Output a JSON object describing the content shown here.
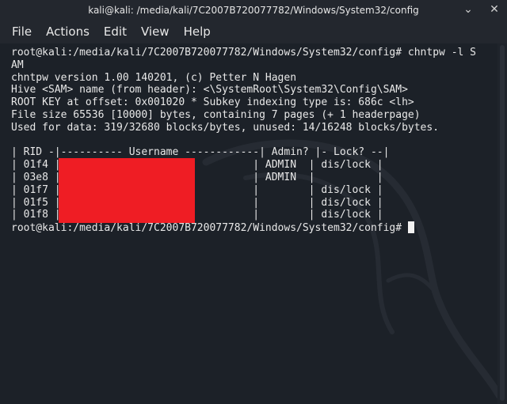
{
  "window": {
    "title": "kali@kali: /media/kali/7C2007B720077782/Windows/System32/config",
    "minimize_icon": "chevron-down-icon",
    "close_icon": "close-icon"
  },
  "menu": {
    "items": [
      "File",
      "Actions",
      "Edit",
      "View",
      "Help"
    ]
  },
  "terminal": {
    "lines": [
      "root@kali:/media/kali/7C2007B720077782/Windows/System32/config# chntpw -l S",
      "AM",
      "chntpw version 1.00 140201, (c) Petter N Hagen",
      "Hive <SAM> name (from header): <\\SystemRoot\\System32\\Config\\SAM>",
      "ROOT KEY at offset: 0x001020 * Subkey indexing type is: 686c <lh>",
      "File size 65536 [10000] bytes, containing 7 pages (+ 1 headerpage)",
      "Used for data: 319/32680 blocks/bytes, unused: 14/16248 blocks/bytes.",
      "",
      "| RID -|---------- Username ------------| Admin? |- Lock? --|",
      "| 01f4 |                               | ADMIN  | dis/lock |",
      "| 03e8 |                               | ADMIN  |          |",
      "| 01f7 |                               |        | dis/lock |",
      "| 01f5 |                               |        | dis/lock |",
      "| 01f8 |                               |        | dis/lock |"
    ],
    "prompt": "root@kali:/media/kali/7C2007B720077782/Windows/System32/config# "
  },
  "colors": {
    "background": "#1c2128",
    "text": "#e8e8e8",
    "redaction": "#ef1d24",
    "titlebar": "#23272e"
  }
}
